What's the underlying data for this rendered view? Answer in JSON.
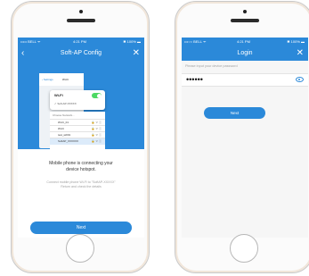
{
  "colors": {
    "accent": "#2b89d9",
    "toggle_on": "#4cd964"
  },
  "config_screen": {
    "status": {
      "carrier": "••••• BELL ᯤ",
      "time": "4:21 PM",
      "battery": "✱ 100% ▬"
    },
    "title": "Soft-AP Config",
    "back_icon": "chevron-left-icon",
    "close_icon": "close-icon",
    "illustration": {
      "settings_back": "‹ Settings",
      "settings_title": "Wi-Fi",
      "wlan_label": "Wi-Fi",
      "connected_network": "✓ Soft-AP-XXXXX",
      "choose_network": "Choose Network...",
      "networks": [
        "Wi-Fi_01",
        "Wi-Fi",
        "test_wifi01",
        "SoftAP_XXXXXX"
      ]
    },
    "message_line1": "Mobile phone is connecting your",
    "message_line2": "device hotspot.",
    "hint_line1": "Connect mobile phone Wi-Fi to \"SoftAP-XXXXX\"",
    "hint_line2": "Return and check the details",
    "next_label": "Next"
  },
  "login_screen": {
    "status": {
      "carrier": "•••○○ BELL ᯤ",
      "time": "4:21 PM",
      "battery": "✱ 100% ▬"
    },
    "title": "Login",
    "close_icon": "close-icon",
    "password_prompt": "Please input your device password",
    "password_value": "••••••",
    "eye_icon": "eye-icon",
    "next_label": "Next"
  }
}
